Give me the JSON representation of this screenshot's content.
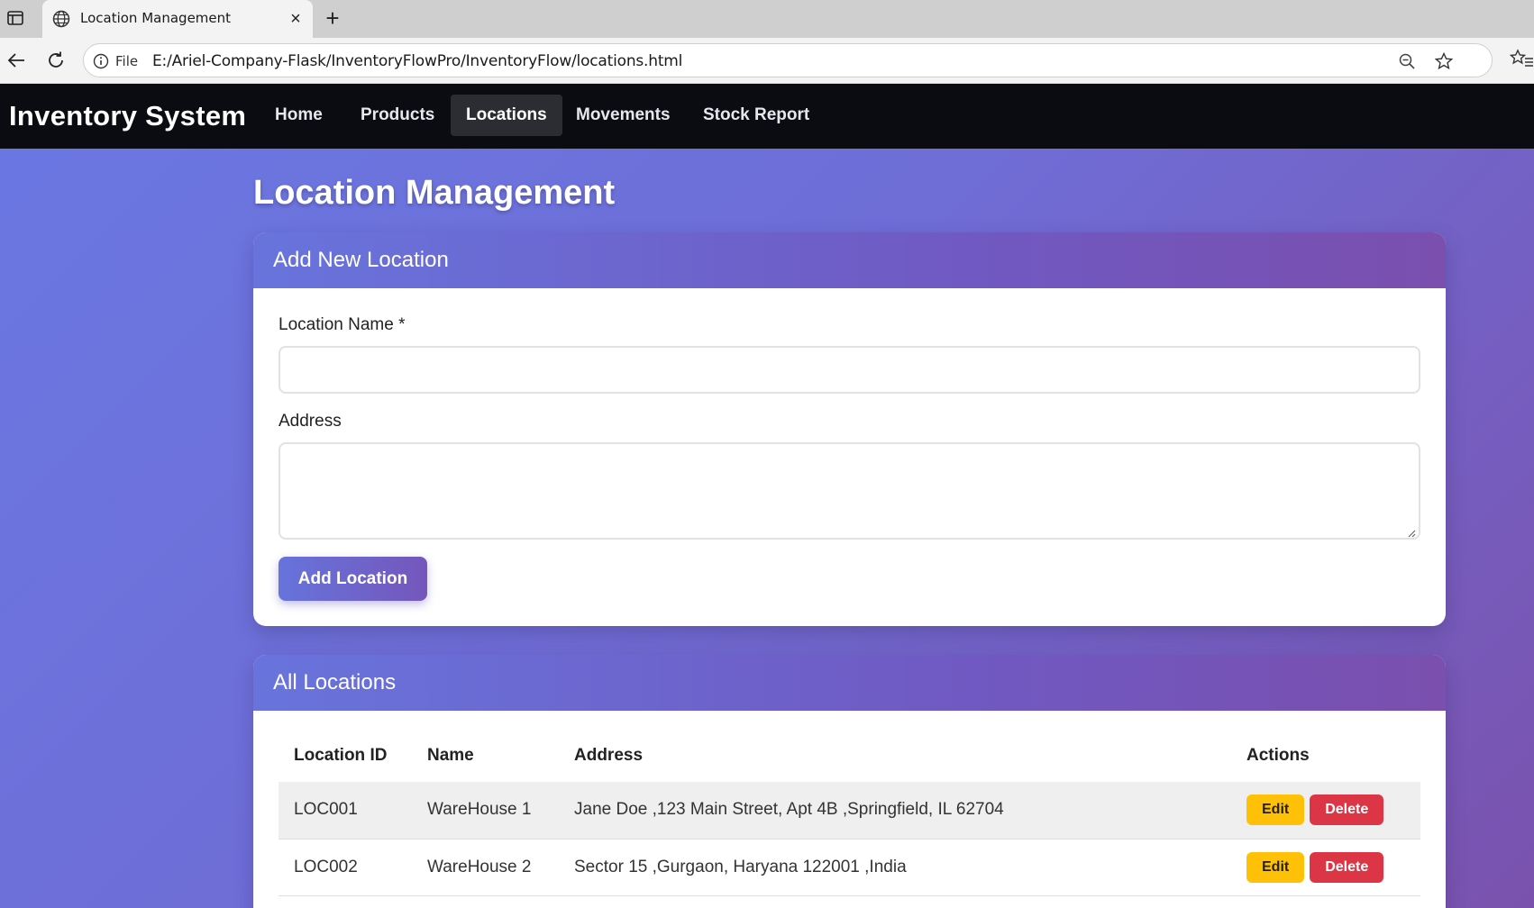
{
  "browser": {
    "tab_title": "Location Management",
    "scheme_label": "File",
    "url": "E:/Ariel-Company-Flask/InventoryFlowPro/InventoryFlow/locations.html"
  },
  "navbar": {
    "brand": "Inventory System",
    "links": [
      {
        "label": "Home",
        "active": false
      },
      {
        "label": "Products",
        "active": false
      },
      {
        "label": "Locations",
        "active": true
      },
      {
        "label": "Movements",
        "active": false
      },
      {
        "label": "Stock Report",
        "active": false
      }
    ]
  },
  "page": {
    "title": "Location Management"
  },
  "add_form": {
    "header": "Add New Location",
    "name_label": "Location Name *",
    "name_value": "",
    "address_label": "Address",
    "address_value": "",
    "submit_label": "Add Location"
  },
  "locations_table": {
    "header": "All Locations",
    "columns": [
      "Location ID",
      "Name",
      "Address",
      "Actions"
    ],
    "rows": [
      {
        "id": "LOC001",
        "name": "WareHouse 1",
        "address": "Jane Doe ,123 Main Street, Apt 4B ,Springfield, IL 62704"
      },
      {
        "id": "LOC002",
        "name": "WareHouse 2",
        "address": "Sector 15 ,Gurgaon, Haryana 122001 ,India"
      }
    ],
    "edit_label": "Edit",
    "delete_label": "Delete"
  },
  "colors": {
    "navbar_bg": "#0b0b12",
    "accent_gradient_start": "#6874dc",
    "accent_gradient_end": "#7a4fae",
    "edit_button": "#ffc107",
    "delete_button": "#dc3545"
  }
}
